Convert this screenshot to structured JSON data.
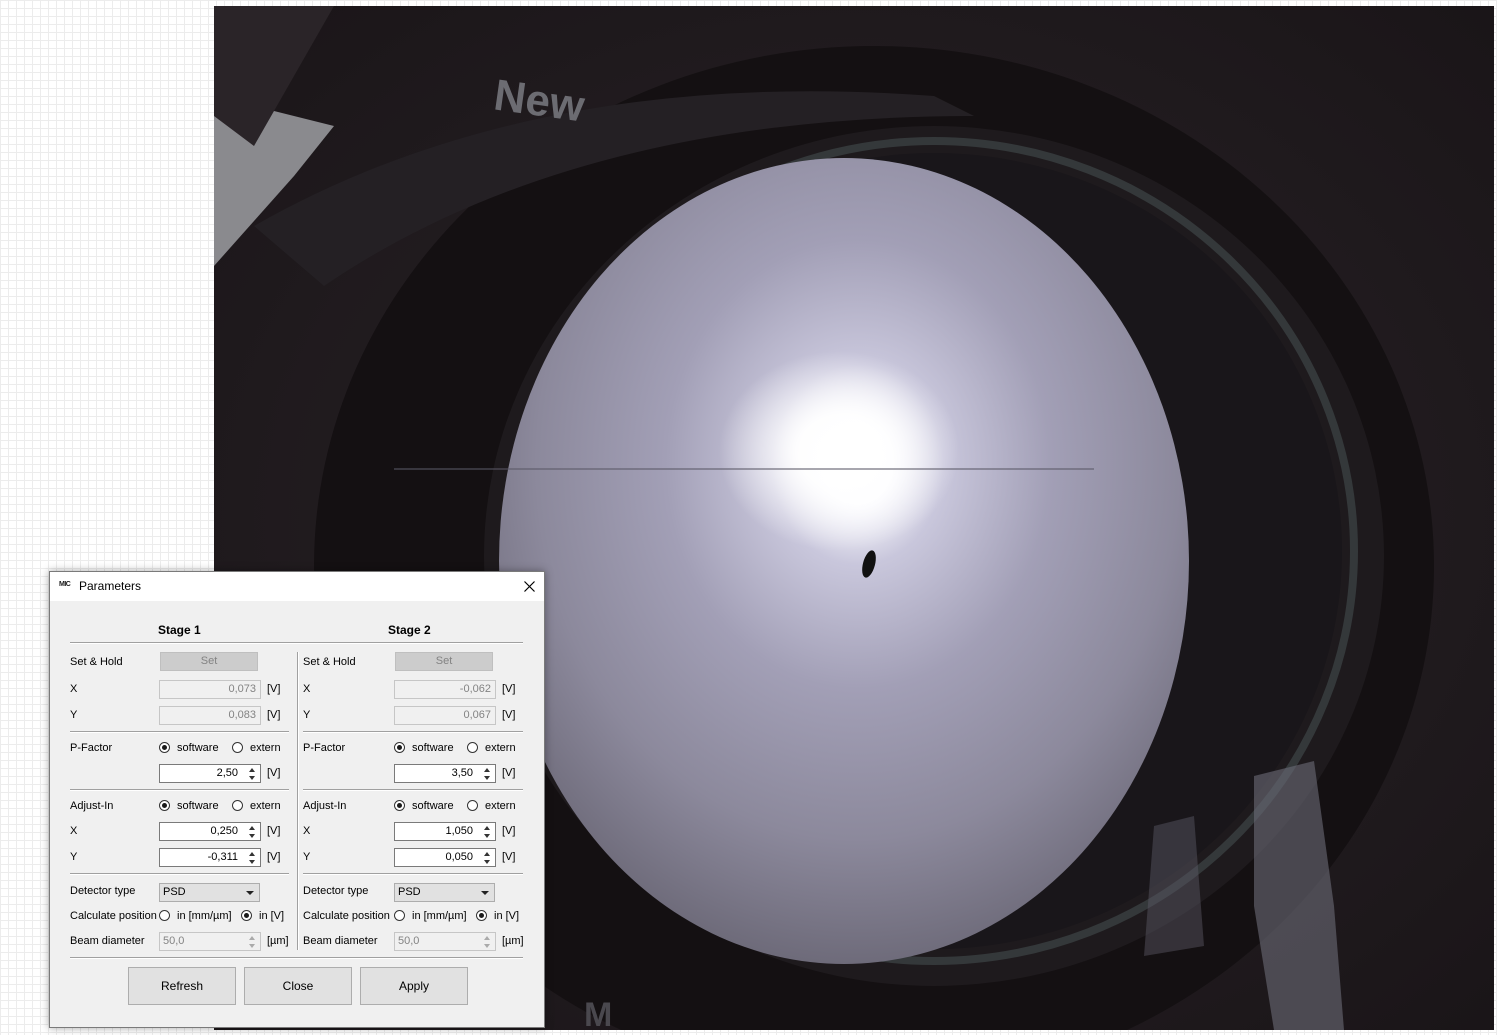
{
  "camera": {
    "brand_text": "New",
    "bottom_text": "M"
  },
  "dialog": {
    "title": "Parameters",
    "app_logo_text": "MIC",
    "stage1": {
      "header": "Stage 1",
      "set_hold_label": "Set & Hold",
      "set_button": "Set",
      "x_label": "X",
      "x_value": "0,073",
      "x_unit": "[V]",
      "y_label": "Y",
      "y_value": "0,083",
      "y_unit": "[V]",
      "pfactor_label": "P-Factor",
      "pfactor_software": "software",
      "pfactor_extern": "extern",
      "pfactor_selected": "software",
      "pfactor_value": "2,50",
      "pfactor_unit": "[V]",
      "adjust_label": "Adjust-In",
      "adjust_software": "software",
      "adjust_extern": "extern",
      "adjust_selected": "software",
      "adjust_x_label": "X",
      "adjust_x_value": "0,250",
      "adjust_x_unit": "[V]",
      "adjust_y_label": "Y",
      "adjust_y_value": "-0,311",
      "adjust_y_unit": "[V]",
      "detector_label": "Detector type",
      "detector_value": "PSD",
      "calc_label": "Calculate position",
      "calc_mm": "in [mm/µm]",
      "calc_v": "in [V]",
      "calc_selected": "in [V]",
      "beam_label": "Beam diameter",
      "beam_value": "50,0",
      "beam_unit": "[µm]"
    },
    "stage2": {
      "header": "Stage 2",
      "set_hold_label": "Set & Hold",
      "set_button": "Set",
      "x_label": "X",
      "x_value": "-0,062",
      "x_unit": "[V]",
      "y_label": "Y",
      "y_value": "0,067",
      "y_unit": "[V]",
      "pfactor_label": "P-Factor",
      "pfactor_software": "software",
      "pfactor_extern": "extern",
      "pfactor_selected": "software",
      "pfactor_value": "3,50",
      "pfactor_unit": "[V]",
      "adjust_label": "Adjust-In",
      "adjust_software": "software",
      "adjust_extern": "extern",
      "adjust_selected": "software",
      "adjust_x_label": "X",
      "adjust_x_value": "1,050",
      "adjust_x_unit": "[V]",
      "adjust_y_label": "Y",
      "adjust_y_value": "0,050",
      "adjust_y_unit": "[V]",
      "detector_label": "Detector type",
      "detector_value": "PSD",
      "calc_label": "Calculate position",
      "calc_mm": "in [mm/µm]",
      "calc_v": "in [V]",
      "calc_selected": "in [V]",
      "beam_label": "Beam diameter",
      "beam_value": "50,0",
      "beam_unit": "[µm]"
    },
    "buttons": {
      "refresh": "Refresh",
      "close": "Close",
      "apply": "Apply"
    }
  }
}
